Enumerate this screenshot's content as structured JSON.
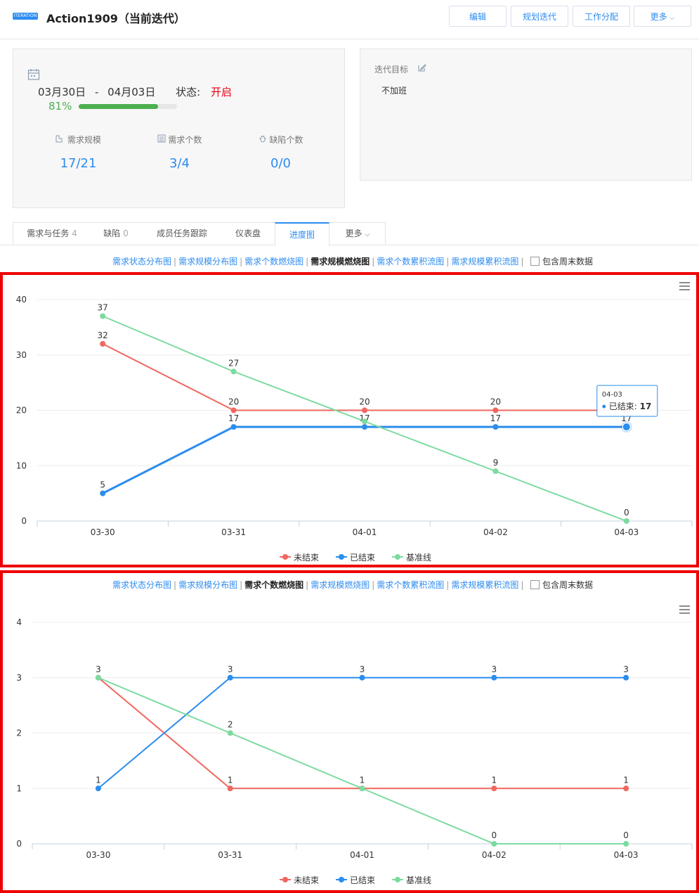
{
  "header": {
    "badge": "ITERATION",
    "title": "Action1909（当前迭代）",
    "buttons": [
      "编辑",
      "规划迭代",
      "工作分配",
      "更多"
    ]
  },
  "summary": {
    "date_start": "03月30日",
    "date_sep": "-",
    "date_end": "04月03日",
    "status_label": "状态:",
    "status_value": "开启",
    "progress_text": "81%",
    "progress": 0.81,
    "metrics": [
      {
        "label": "需求规模",
        "value": "17/21",
        "icon": "chart-icon"
      },
      {
        "label": "需求个数",
        "value": "3/4",
        "icon": "list-icon"
      },
      {
        "label": "缺陷个数",
        "value": "0/0",
        "icon": "bug-icon"
      }
    ]
  },
  "goal": {
    "label": "迭代目标",
    "text": "不加班"
  },
  "tabs": [
    {
      "label": "需求与任务",
      "count": "4"
    },
    {
      "label": "缺陷",
      "count": "0"
    },
    {
      "label": "成员任务跟踪",
      "count": ""
    },
    {
      "label": "仪表盘",
      "count": ""
    },
    {
      "label": "进度图",
      "count": ""
    },
    {
      "label": "更多",
      "count": ""
    }
  ],
  "sub_links": [
    "需求状态分布图",
    "需求规模分布图",
    "需求个数燃烧图",
    "需求规模燃烧图",
    "需求个数累积流图",
    "需求规模累积流图"
  ],
  "weekend_label": "包含周末数据",
  "colors": {
    "unfinished": "#f0675f",
    "finished": "#2b8ded",
    "baseline": "#7cdba0",
    "accent": "#2d8cf0",
    "status": "#e60012"
  },
  "chart_data": [
    {
      "type": "line",
      "categories": [
        "03-30",
        "03-31",
        "04-01",
        "04-02",
        "04-03"
      ],
      "ylim": [
        0,
        40
      ],
      "yticks": [
        0,
        10,
        20,
        30,
        40
      ],
      "grid": true,
      "legend": "bottom-center",
      "series": [
        {
          "name": "未结束",
          "values": [
            32,
            20,
            20,
            20,
            20
          ]
        },
        {
          "name": "已结束",
          "values": [
            5,
            17,
            17,
            17,
            17
          ]
        },
        {
          "name": "基准线",
          "values": [
            37,
            27,
            18,
            9,
            0
          ]
        }
      ],
      "labels": {
        "未结束": [
          "32",
          "20",
          "20",
          "20",
          ""
        ],
        "已结束": [
          "5",
          "17",
          "17",
          "17",
          "17"
        ],
        "基准线": [
          "37",
          "27",
          "",
          "9",
          "0"
        ]
      },
      "tooltip": {
        "category": "04-03",
        "series": "已结束",
        "value": "17"
      }
    },
    {
      "type": "line",
      "categories": [
        "03-30",
        "03-31",
        "04-01",
        "04-02",
        "04-03"
      ],
      "ylim": [
        0,
        4
      ],
      "yticks": [
        0,
        1,
        2,
        3,
        4
      ],
      "grid": true,
      "legend": "bottom-center",
      "series": [
        {
          "name": "未结束",
          "values": [
            3,
            1,
            1,
            1,
            1
          ]
        },
        {
          "name": "已结束",
          "values": [
            1,
            3,
            3,
            3,
            3
          ]
        },
        {
          "name": "基准线",
          "values": [
            3,
            2,
            1,
            0,
            0
          ]
        }
      ],
      "labels": {
        "未结束": [
          "",
          "1",
          "1",
          "1",
          "1"
        ],
        "已结束": [
          "1",
          "3",
          "3",
          "3",
          "3"
        ],
        "基准线": [
          "3",
          "2",
          "",
          "0",
          "0"
        ]
      }
    }
  ]
}
